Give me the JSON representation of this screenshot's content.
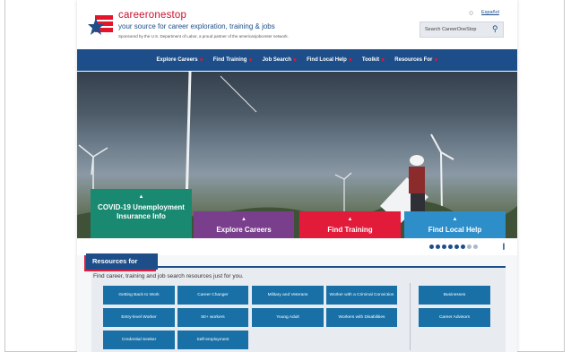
{
  "header": {
    "brand": "careeronestop",
    "tagline": "your source for career exploration, training & jobs",
    "sponsor": "Sponsored by the U.S. Department of Labor, a proud partner of the americanjobcenter network.",
    "language_link": "Español",
    "search_label": "Search CareerOneStop"
  },
  "nav": {
    "items": [
      {
        "label": "Explore Careers"
      },
      {
        "label": "Find Training"
      },
      {
        "label": "Job Search"
      },
      {
        "label": "Find Local Help"
      },
      {
        "label": "Toolkit"
      },
      {
        "label": "Resources For"
      }
    ]
  },
  "hero": {
    "tiles": [
      {
        "label": "COVID-19 Unemployment Insurance Info",
        "color": "#198a71"
      },
      {
        "label": "Explore Careers",
        "color": "#7a3f8c"
      },
      {
        "label": "Find Training",
        "color": "#e31b3b"
      },
      {
        "label": "Find Local Help",
        "color": "#2e8ec9"
      }
    ],
    "slides_total": 8,
    "active_slide": 1,
    "pause_glyph": "❙"
  },
  "resources": {
    "tab_label": "Resources for",
    "intro": "Find career, training and job search resources just for you.",
    "buttons_left": [
      [
        "Getting Back to Work",
        "Career Changer",
        "Military and Veterans",
        "Worker with a Criminal Conviction"
      ],
      [
        "Entry-level Worker",
        "50+ workers",
        "Young Adult",
        "Workers with Disabilities"
      ],
      [
        "Credential Seeker",
        "Self-employment"
      ]
    ],
    "buttons_right": [
      "Businesses",
      "Career Advisors"
    ]
  },
  "colors": {
    "brand_blue": "#1d4e89",
    "brand_red": "#e31b3b",
    "button_blue": "#1870a6"
  }
}
